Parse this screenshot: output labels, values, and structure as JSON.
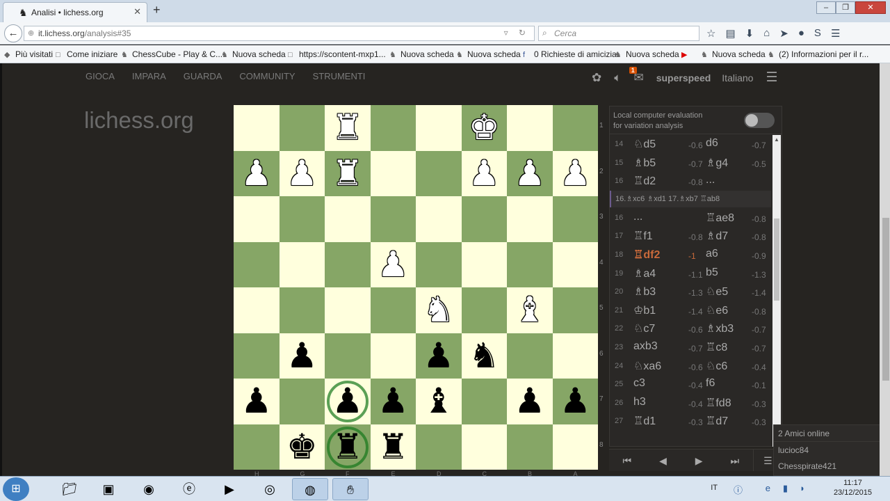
{
  "browser": {
    "tab_title": "Analisi • lichess.org",
    "new_tab": "+",
    "url_host": "it.lichess.org",
    "url_path": "/analysis#35",
    "search_placeholder": "Cerca",
    "bookmarks": [
      "Più visitati",
      "Come iniziare",
      "ChessCube - Play & C...",
      "Nuova scheda",
      "https://scontent-mxp1...",
      "Nuova scheda",
      "Nuova scheda",
      "0 Richieste di amicizia",
      "Nuova scheda",
      "Nuova scheda",
      "(2) Informazioni per il r..."
    ]
  },
  "site": {
    "nav": [
      "GIOCA",
      "IMPARA",
      "GUARDA",
      "COMMUNITY",
      "STRUMENTI"
    ],
    "logo": "lichess.org",
    "username": "superspeed",
    "language": "Italiano",
    "mail_count": "1"
  },
  "board": {
    "ranks": [
      "1",
      "2",
      "3",
      "4",
      "5",
      "6",
      "7",
      "8"
    ],
    "files": [
      "H",
      "G",
      "F",
      "E",
      "D",
      "C",
      "B",
      "A"
    ],
    "colors": {
      "light": "#ffffdd",
      "dark": "#86a666"
    },
    "pieces": [
      {
        "sq": "f1",
        "g": "♜",
        "c": "w"
      },
      {
        "sq": "c1",
        "g": "♚",
        "c": "w"
      },
      {
        "sq": "h2",
        "g": "♟",
        "c": "w"
      },
      {
        "sq": "g2",
        "g": "♟",
        "c": "w"
      },
      {
        "sq": "f2",
        "g": "♜",
        "c": "w"
      },
      {
        "sq": "c2",
        "g": "♟",
        "c": "w"
      },
      {
        "sq": "b2",
        "g": "♟",
        "c": "w"
      },
      {
        "sq": "a2",
        "g": "♟",
        "c": "w"
      },
      {
        "sq": "e4",
        "g": "♟",
        "c": "w"
      },
      {
        "sq": "d5",
        "g": "♞",
        "c": "w"
      },
      {
        "sq": "b5",
        "g": "♝",
        "c": "w"
      },
      {
        "sq": "g6",
        "g": "♟",
        "c": "b"
      },
      {
        "sq": "d6",
        "g": "♟",
        "c": "b"
      },
      {
        "sq": "c6",
        "g": "♞",
        "c": "b"
      },
      {
        "sq": "h7",
        "g": "♟",
        "c": "b"
      },
      {
        "sq": "f7",
        "g": "♟",
        "c": "b"
      },
      {
        "sq": "e7",
        "g": "♟",
        "c": "b"
      },
      {
        "sq": "d7",
        "g": "♝",
        "c": "b"
      },
      {
        "sq": "b7",
        "g": "♟",
        "c": "b"
      },
      {
        "sq": "a7",
        "g": "♟",
        "c": "b"
      },
      {
        "sq": "g8",
        "g": "♚",
        "c": "b"
      },
      {
        "sq": "f8",
        "g": "♜",
        "c": "b"
      },
      {
        "sq": "e8",
        "g": "♜",
        "c": "b"
      }
    ],
    "highlights": [
      "f7",
      "f8"
    ]
  },
  "panel": {
    "ceval_line1": "Local computer evaluation",
    "ceval_line2": "for variation analysis",
    "variation": "16.♗xc6  ♗xd1  17.♗xb7  ♖ab8",
    "moves": [
      {
        "n": "14",
        "w": "♘d5",
        "we": "-0.6",
        "b": "d6",
        "be": "-0.7"
      },
      {
        "n": "15",
        "w": "♗b5",
        "we": "-0.7",
        "b": "♗g4",
        "be": "-0.5"
      },
      {
        "n": "16",
        "w": "♖d2",
        "we": "-0.8",
        "b": "...",
        "be": ""
      },
      {
        "n": "16",
        "w": "...",
        "we": "",
        "b": "♖ae8",
        "be": "-0.8"
      },
      {
        "n": "17",
        "w": "♖f1",
        "we": "-0.8",
        "b": "♗d7",
        "be": "-0.8"
      },
      {
        "n": "18",
        "w": "♖df2",
        "we": "-1",
        "b": "a6",
        "be": "-0.9",
        "current": true
      },
      {
        "n": "19",
        "w": "♗a4",
        "we": "-1.1",
        "b": "b5",
        "be": "-1.3"
      },
      {
        "n": "20",
        "w": "♗b3",
        "we": "-1.3",
        "b": "♘e5",
        "be": "-1.4"
      },
      {
        "n": "21",
        "w": "♔b1",
        "we": "-1.4",
        "b": "♘e6",
        "be": "-0.8"
      },
      {
        "n": "22",
        "w": "♘c7",
        "we": "-0.6",
        "b": "♗xb3",
        "be": "-0.7"
      },
      {
        "n": "23",
        "w": "axb3",
        "we": "-0.7",
        "b": "♖c8",
        "be": "-0.7"
      },
      {
        "n": "24",
        "w": "♘xa6",
        "we": "-0.6",
        "b": "♘c6",
        "be": "-0.4"
      },
      {
        "n": "25",
        "w": "c3",
        "we": "-0.4",
        "b": "f6",
        "be": "-0.1"
      },
      {
        "n": "26",
        "w": "h3",
        "we": "-0.4",
        "b": "♖fd8",
        "be": "-0.3"
      },
      {
        "n": "27",
        "w": "♖d1",
        "we": "-0.3",
        "b": "♖d7",
        "be": "-0.3"
      }
    ]
  },
  "friends": {
    "header": "2 Amici online",
    "users": [
      "lucioc84",
      "Chesspirate421"
    ]
  },
  "taskbar": {
    "lang": "IT",
    "time": "11:17",
    "date": "23/12/2015"
  }
}
